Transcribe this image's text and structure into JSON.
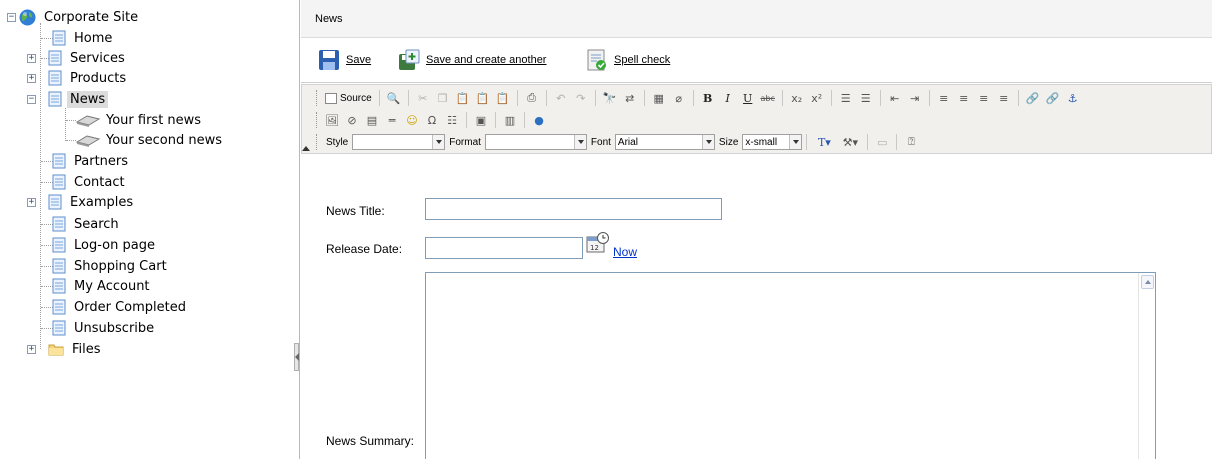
{
  "tree": {
    "root": "Corporate Site",
    "items": [
      {
        "label": "Home"
      },
      {
        "label": "Services"
      },
      {
        "label": "Products"
      },
      {
        "label": "News"
      },
      {
        "label": "Your first news"
      },
      {
        "label": "Your second news"
      },
      {
        "label": "Partners"
      },
      {
        "label": "Contact"
      },
      {
        "label": "Examples"
      },
      {
        "label": "Search"
      },
      {
        "label": "Log-on page"
      },
      {
        "label": "Shopping Cart"
      },
      {
        "label": "My Account"
      },
      {
        "label": "Order Completed"
      },
      {
        "label": "Unsubscribe"
      },
      {
        "label": "Files"
      }
    ],
    "selected": "News"
  },
  "header": {
    "title": "News"
  },
  "actions": {
    "save": "Save",
    "save_create": "Save and create another",
    "spell": "Spell check"
  },
  "editor": {
    "source_label": "Source",
    "style_label": "Style",
    "style_value": "",
    "format_label": "Format",
    "format_value": "",
    "font_label": "Font",
    "font_value": "Arial",
    "size_label": "Size",
    "size_value": "x-small"
  },
  "form": {
    "title_label": "News Title:",
    "title_value": "",
    "date_label": "Release Date:",
    "date_value": "",
    "now_link": "Now",
    "summary_label": "News Summary:",
    "summary_value": ""
  },
  "colors": {
    "link": "#0033cc",
    "input_border": "#7f9db9",
    "toolbar_bg": "#f1f0ed",
    "selected_bg": "#dcdcdc"
  }
}
